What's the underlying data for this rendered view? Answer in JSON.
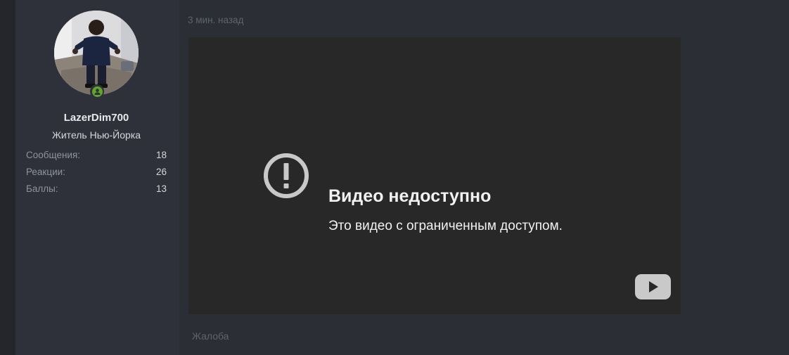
{
  "colors": {
    "background": "#2b2e35",
    "sidebar": "#2e313a",
    "video_bg": "#282828",
    "online": "#5fa62b"
  },
  "user": {
    "username": "LazerDim700",
    "title": "Житель Нью-Йорка",
    "online_icon": "user-online-icon",
    "stats": [
      {
        "label": "Сообщения:",
        "value": "18"
      },
      {
        "label": "Реакции:",
        "value": "26"
      },
      {
        "label": "Баллы:",
        "value": "13"
      }
    ]
  },
  "post": {
    "timestamp": "3 мин. назад",
    "video": {
      "title": "Видео недоступно",
      "subtitle": "Это видео с ограниченным доступом.",
      "icon": "alert-circle-icon",
      "logo": "youtube-logo-icon"
    },
    "report_label": "Жалоба"
  }
}
